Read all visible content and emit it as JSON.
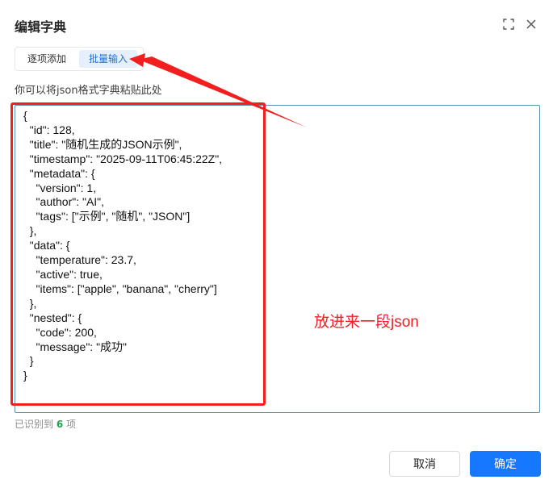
{
  "dialog": {
    "title": "编辑字典"
  },
  "tabs": [
    {
      "label": "逐项添加",
      "active": false
    },
    {
      "label": "批量输入",
      "active": true
    }
  ],
  "hint": "你可以将json格式字典粘贴此处",
  "editor": {
    "value": "{\n  \"id\": 128,\n  \"title\": \"随机生成的JSON示例\",\n  \"timestamp\": \"2025-09-11T06:45:22Z\",\n  \"metadata\": {\n    \"version\": 1,\n    \"author\": \"AI\",\n    \"tags\": [\"示例\", \"随机\", \"JSON\"]\n  },\n  \"data\": {\n    \"temperature\": 23.7,\n    \"active\": true,\n    \"items\": [\"apple\", \"banana\", \"cherry\"]\n  },\n  \"nested\": {\n    \"code\": 200,\n    \"message\": \"成功\"\n  }\n}"
  },
  "annotation": {
    "text": "放进来一段json",
    "color": "#f0202a"
  },
  "status": {
    "prefix": "已识别到",
    "count": "6",
    "suffix": "项"
  },
  "footer": {
    "cancel_label": "取消",
    "ok_label": "确定"
  },
  "icons": {
    "expand": "fullscreen-icon",
    "close": "close-icon"
  },
  "colors": {
    "primary": "#1677ff",
    "annotation_red": "#f21f1f",
    "count_green": "#22a34b"
  }
}
